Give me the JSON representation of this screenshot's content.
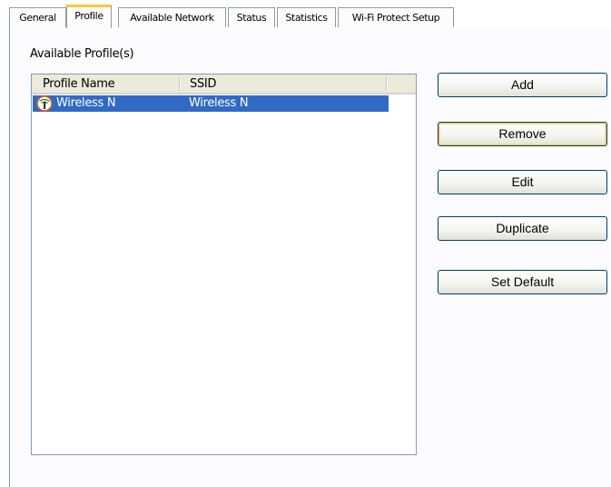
{
  "tabs": [
    {
      "label": "General"
    },
    {
      "label": "Profile",
      "active": true
    },
    {
      "label": "Available Network"
    },
    {
      "label": "Status"
    },
    {
      "label": "Statistics"
    },
    {
      "label": "Wi-Fi Protect Setup"
    }
  ],
  "profiles_group": {
    "label": "Available Profile(s)",
    "columns": [
      "Profile Name",
      "SSID"
    ],
    "rows": [
      {
        "profile_name": "Wireless N",
        "ssid": "Wireless N",
        "selected": true,
        "icon": "wireless-profile-icon"
      }
    ]
  },
  "buttons": {
    "add": "Add",
    "remove": "Remove",
    "edit": "Edit",
    "duplicate": "Duplicate",
    "set_default": "Set Default"
  },
  "colors": {
    "selection": "#316ac5",
    "active_tab_accent": "#ffc83c",
    "button_border": "#003c74",
    "focus_ring": "#f5c66c"
  }
}
